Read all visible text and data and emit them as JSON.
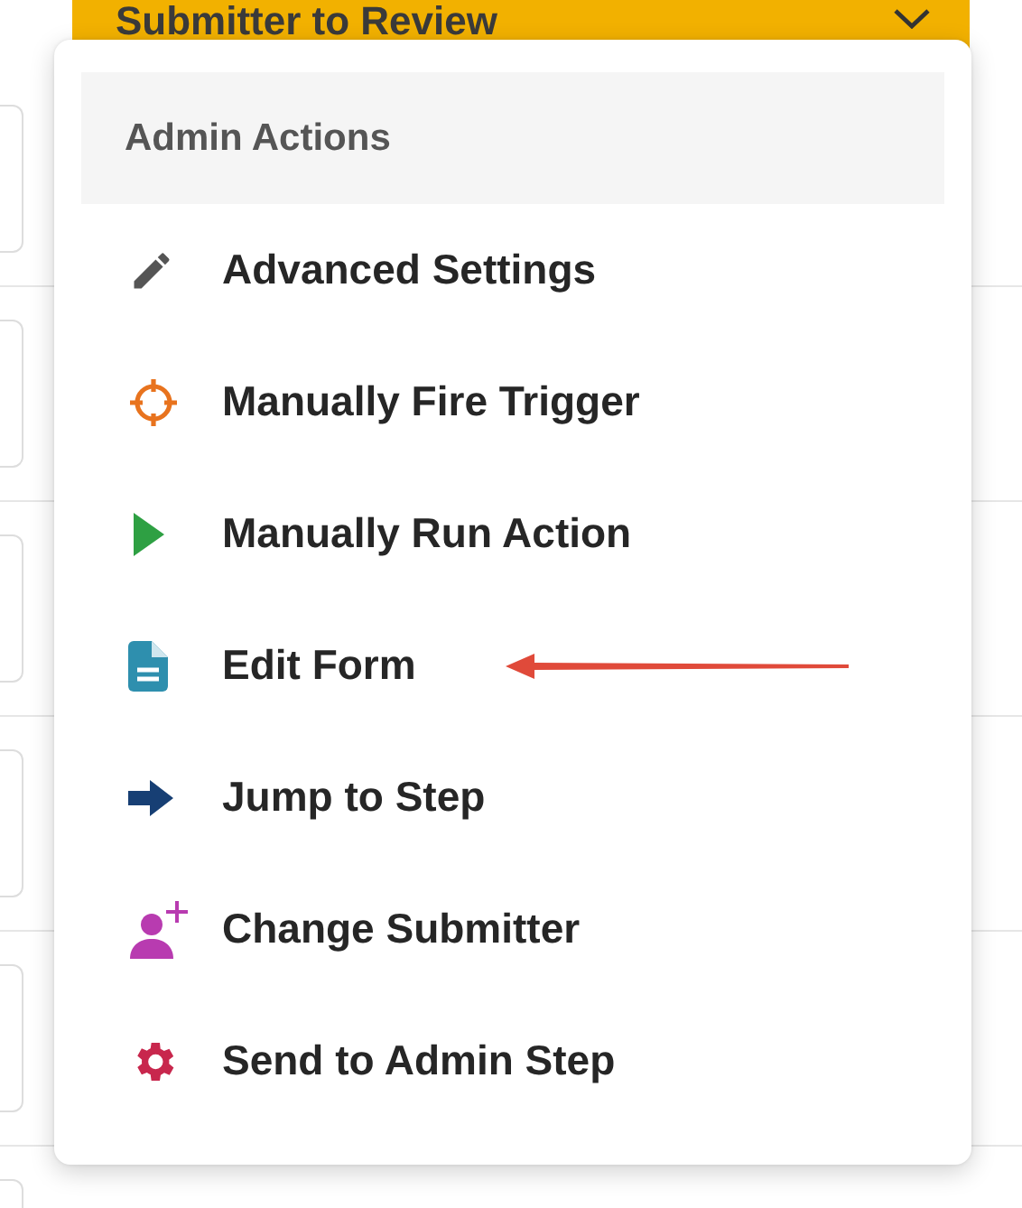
{
  "status_bar": {
    "label": "Submitter to Review",
    "expanded": false
  },
  "menu": {
    "header": "Admin Actions",
    "items": [
      {
        "label": "Advanced Settings",
        "kind": "pencil"
      },
      {
        "label": "Manually Fire Trigger",
        "kind": "crosshair"
      },
      {
        "label": "Manually Run Action",
        "kind": "play"
      },
      {
        "label": "Edit Form",
        "kind": "document",
        "annotated": true
      },
      {
        "label": "Jump to Step",
        "kind": "arrow"
      },
      {
        "label": "Change Submitter",
        "kind": "user-plus"
      },
      {
        "label": "Send to Admin Step",
        "kind": "gear"
      }
    ]
  }
}
